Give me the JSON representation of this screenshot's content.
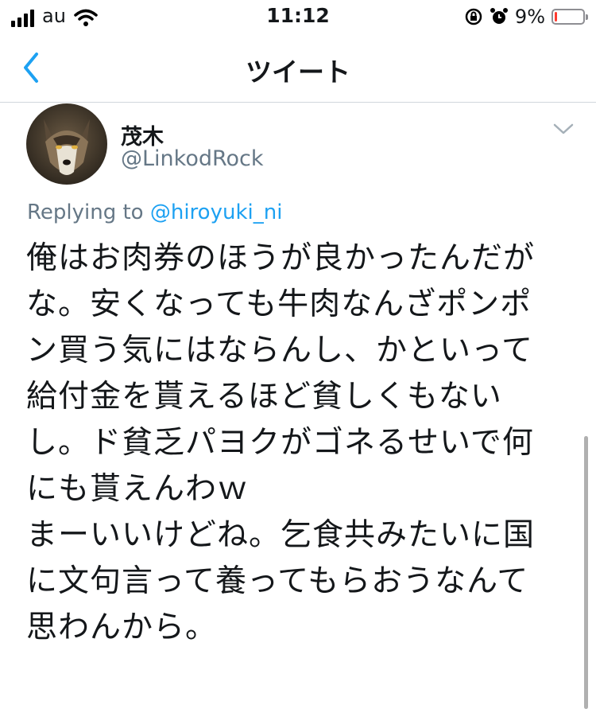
{
  "status_bar": {
    "carrier": "au",
    "time": "11:12",
    "battery_percent": "9%",
    "battery_level": 0.09,
    "battery_color": "#ff3b30"
  },
  "nav": {
    "title": "ツイート",
    "back_icon": "chevron-left-icon",
    "accent": "#1da1f2"
  },
  "tweet": {
    "author_name": "茂木",
    "author_handle": "@LinkodRock",
    "replying_to_prefix": "Replying to",
    "replying_to_handle": "@hiroyuki_ni",
    "lines": [
      "俺はお肉券のほうが良かったんだが",
      "な。安くなっても牛肉なんざポンポ",
      "ン買う気にはならんし、かといって",
      "給付金を貰えるほど貧しくもない",
      "し。ド貧乏パヨクがゴネるせいで何",
      "にも貰えんわｗ",
      "まーいいけどね。乞食共みたいに国",
      "に文句言って養ってもらおうなんて",
      "思わんから。"
    ]
  }
}
